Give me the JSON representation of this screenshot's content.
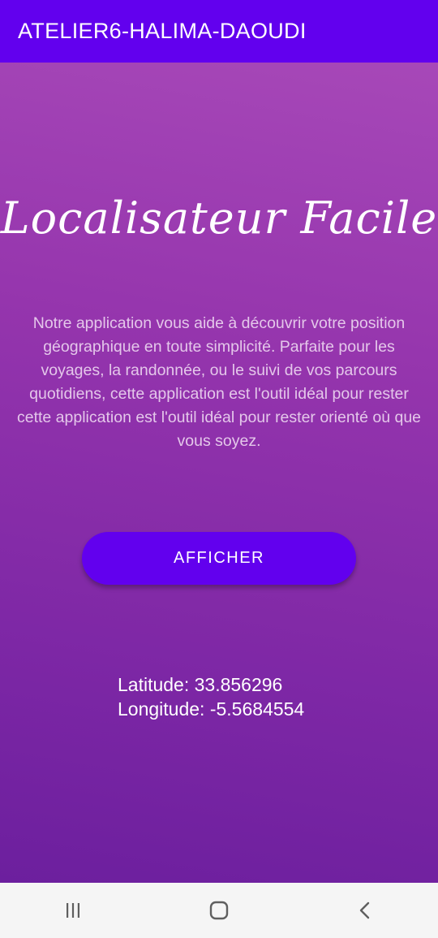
{
  "app_bar": {
    "title": "ATELIER6-HALIMA-DAOUDI",
    "color": "#6200ee"
  },
  "main": {
    "headline": "Localisateur Facile",
    "description": "Notre application vous aide à découvrir votre position géographique en toute simplicité. Parfaite pour les voyages, la randonnée, ou le suivi de vos parcours quotidiens, cette application est l'outil idéal pour rester cette application est l'outil idéal pour rester orienté où que vous soyez.",
    "button_label": "AFFICHER",
    "latitude_text": "Latitude: 33.856296",
    "longitude_text": "Longitude: -5.5684554",
    "gradient_top": "#a748b8",
    "gradient_bottom": "#6c1f9e"
  },
  "nav_bar": {
    "items": [
      {
        "icon": "recent-apps-icon"
      },
      {
        "icon": "home-icon"
      },
      {
        "icon": "back-icon"
      }
    ]
  }
}
